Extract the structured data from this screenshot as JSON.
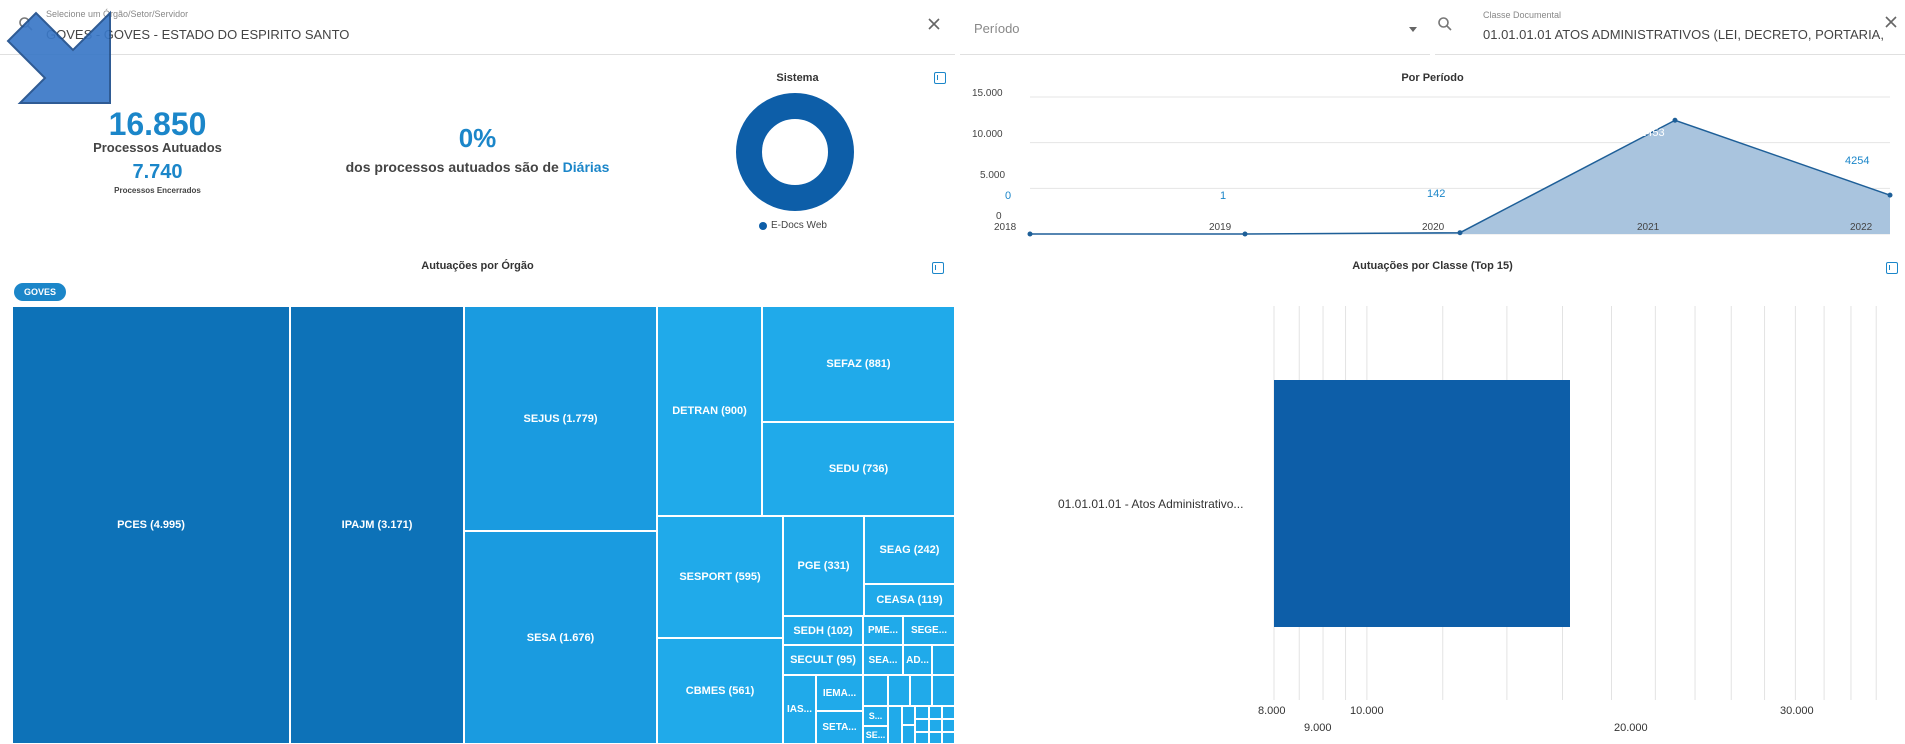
{
  "filters": {
    "orgao": {
      "label": "Selecione um Órgão/Setor/Servidor",
      "value": "GOVES - GOVES - ESTADO DO ESPIRITO SANTO"
    },
    "periodo": {
      "placeholder": "Período"
    },
    "classe": {
      "label": "Classe Documental",
      "value": "01.01.01.01 ATOS ADMINISTRATIVOS (LEI, DECRETO, PORTARIA,"
    }
  },
  "kpi": {
    "autuados_value": "16.850",
    "autuados_label": "Processos Autuados",
    "encerrados_value": "7.740",
    "encerrados_label": "Processos Encerrados"
  },
  "diarias": {
    "percent": "0%",
    "text_prefix": "dos processos autuados são de",
    "text_highlight": "Diárias"
  },
  "sistema": {
    "title": "Sistema",
    "legend": "E-Docs Web",
    "color": "#0d5ea8"
  },
  "periodo_chart": {
    "title": "Por Período",
    "y_ticks": [
      "15.000",
      "10.000",
      "5.000",
      "0"
    ],
    "x_labels": [
      "2018",
      "2019",
      "2020",
      "2021",
      "2022"
    ],
    "data_labels": [
      "0",
      "1",
      "142",
      "12453",
      "4254"
    ]
  },
  "chart_data": [
    {
      "type": "area",
      "title": "Por Período",
      "x": [
        "2018",
        "2019",
        "2020",
        "2021",
        "2022"
      ],
      "values": [
        0,
        1,
        142,
        12453,
        4254
      ],
      "ylim": [
        0,
        15000
      ],
      "grid": true
    },
    {
      "type": "bar",
      "title": "Autuações por Classe (Top 15)",
      "orientation": "horizontal",
      "categories": [
        "01.01.01.01 - Atos Administrativo..."
      ],
      "values": [
        16850
      ],
      "xlim": [
        8000,
        35000
      ],
      "grid": true
    }
  ],
  "orgao_chart": {
    "title": "Autuações por Órgão",
    "chip": "GOVES",
    "cells": [
      "PCES (4.995)",
      "IPAJM (3.171)",
      "SEJUS (1.779)",
      "SESA (1.676)",
      "DETRAN (900)",
      "SEFAZ (881)",
      "SEDU (736)",
      "SESPORT (595)",
      "CBMES (561)",
      "PGE (331)",
      "SEAG (242)",
      "CEASA (119)",
      "SEDH (102)",
      "SECULT (95)",
      "PME...",
      "SEGE...",
      "SEA...",
      "AD...",
      "IEMA...",
      "IAS...",
      "SETA...",
      "S...",
      "SE..."
    ]
  },
  "classe_chart": {
    "title": "Autuações por Classe (Top 15)",
    "category_label": "01.01.01.01 - Atos Administrativo...",
    "x_ticks_top": [
      "8.000",
      "10.000",
      "30.000"
    ],
    "x_ticks_bottom": [
      "9.000",
      "20.000"
    ],
    "bar_color": "#0d5ea8"
  }
}
